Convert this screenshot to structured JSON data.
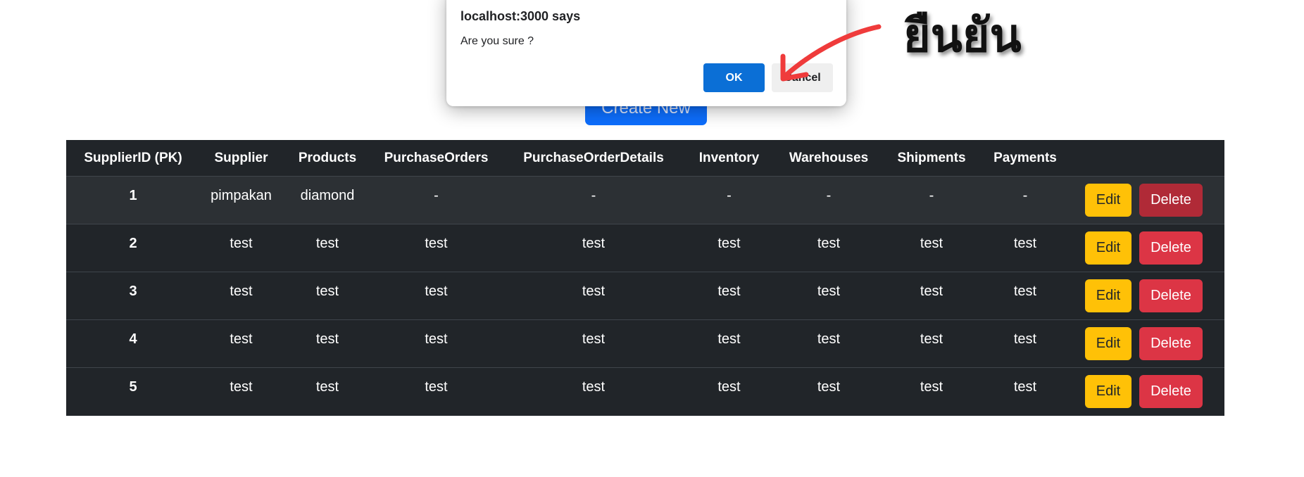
{
  "page": {
    "create_button_label": "Create New"
  },
  "table": {
    "headers": [
      "SupplierID (PK)",
      "Supplier",
      "Products",
      "PurchaseOrders",
      "PurchaseOrderDetails",
      "Inventory",
      "Warehouses",
      "Shipments",
      "Payments",
      ""
    ],
    "rows": [
      {
        "id": "1",
        "supplier": "pimpakan",
        "products": "diamond",
        "purchase_orders": "-",
        "purchase_order_details": "-",
        "inventory": "-",
        "warehouses": "-",
        "shipments": "-",
        "payments": "-"
      },
      {
        "id": "2",
        "supplier": "test",
        "products": "test",
        "purchase_orders": "test",
        "purchase_order_details": "test",
        "inventory": "test",
        "warehouses": "test",
        "shipments": "test",
        "payments": "test"
      },
      {
        "id": "3",
        "supplier": "test",
        "products": "test",
        "purchase_orders": "test",
        "purchase_order_details": "test",
        "inventory": "test",
        "warehouses": "test",
        "shipments": "test",
        "payments": "test"
      },
      {
        "id": "4",
        "supplier": "test",
        "products": "test",
        "purchase_orders": "test",
        "purchase_order_details": "test",
        "inventory": "test",
        "warehouses": "test",
        "shipments": "test",
        "payments": "test"
      },
      {
        "id": "5",
        "supplier": "test",
        "products": "test",
        "purchase_orders": "test",
        "purchase_order_details": "test",
        "inventory": "test",
        "warehouses": "test",
        "shipments": "test",
        "payments": "test"
      }
    ],
    "edit_label": "Edit",
    "delete_label": "Delete"
  },
  "dialog": {
    "title": "localhost:3000 says",
    "message": "Are you sure ?",
    "ok_label": "OK",
    "cancel_label": "Cancel"
  },
  "annotation": {
    "text": "ยืนยัน",
    "arrow_color": "#ef3b3b"
  },
  "colors": {
    "table_bg": "#212529",
    "edit_button": "#ffc107",
    "delete_button": "#dc3545",
    "primary_button": "#0d6efd",
    "dialog_ok": "#0b6fd6"
  }
}
